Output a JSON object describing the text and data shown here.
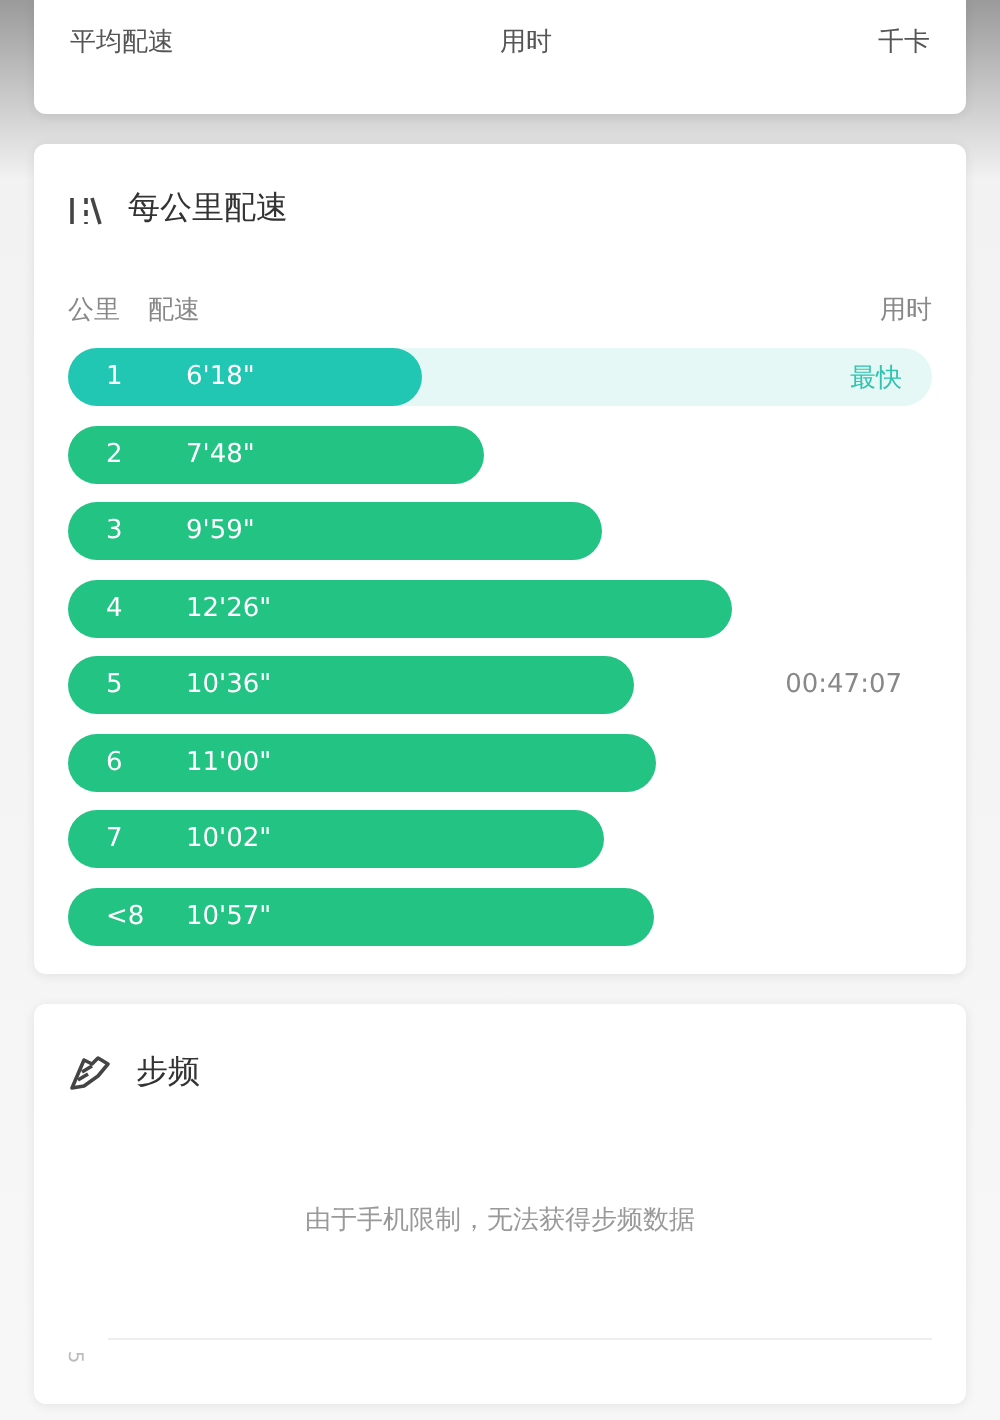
{
  "summary": {
    "labels": [
      "平均配速",
      "用时",
      "千卡"
    ]
  },
  "pace_card": {
    "title": "每公里配速",
    "columns": [
      "公里",
      "配速",
      "用时"
    ],
    "rows": [
      {
        "km": "1",
        "pace": "6'18\"",
        "level": 0.41,
        "fastest": true,
        "note": "最快"
      },
      {
        "km": "2",
        "pace": "7'48\"",
        "fastest": false
      },
      {
        "km": "3",
        "pace": "9'59\"",
        "fastest": false
      },
      {
        "km": "4",
        "pace": "12'26\"",
        "fastest": false
      },
      {
        "km": "5",
        "pace": "10'36\"",
        "fastest": false,
        "note": "00:47:07"
      },
      {
        "km": "6",
        "pace": "11'00\"",
        "fastest": false
      },
      {
        "km": "7",
        "pace": "10'02\"",
        "fastest": false
      },
      {
        "km": "<8",
        "pace": "10'57\"",
        "fastest": false
      }
    ]
  },
  "cadence_card": {
    "title": "步频",
    "message": "由于手机限制，无法获得步频数据",
    "axis_tick": "5"
  }
}
